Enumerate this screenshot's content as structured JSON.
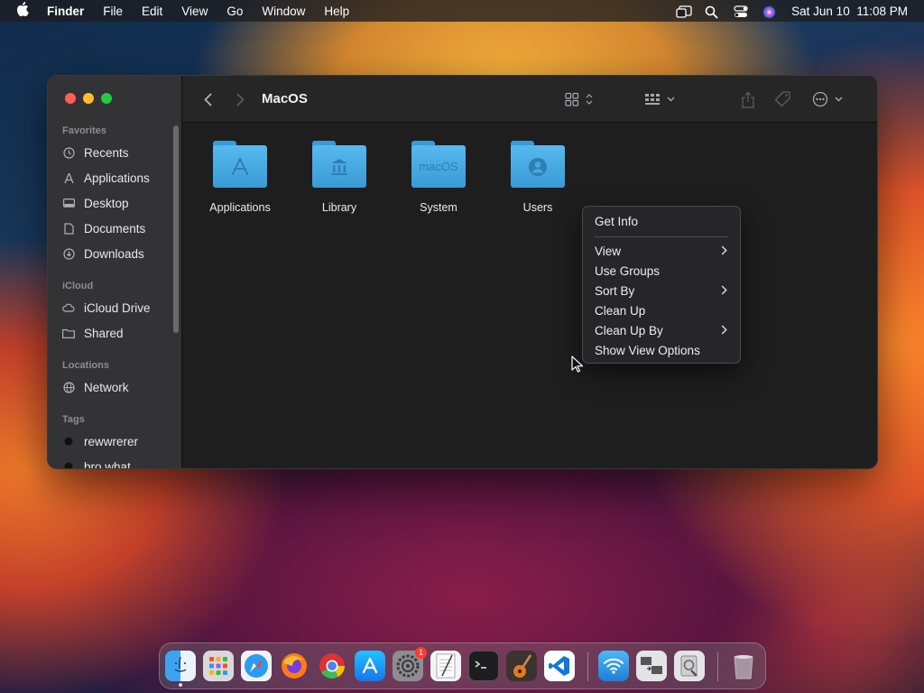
{
  "menubar": {
    "app_name": "Finder",
    "items": [
      "File",
      "Edit",
      "View",
      "Go",
      "Window",
      "Help"
    ],
    "datetime": "Sat Jun 10  11:08 PM"
  },
  "window": {
    "title": "MacOS",
    "sidebar": {
      "favorites_header": "Favorites",
      "favorites": [
        "Recents",
        "Applications",
        "Desktop",
        "Documents",
        "Downloads"
      ],
      "icloud_header": "iCloud",
      "icloud": [
        "iCloud Drive",
        "Shared"
      ],
      "locations_header": "Locations",
      "locations": [
        "Network"
      ],
      "tags_header": "Tags",
      "tags": [
        "rewwrerer",
        "bro what"
      ]
    },
    "folders": [
      {
        "label": "Applications",
        "icon": "app-store-glyph"
      },
      {
        "label": "Library",
        "icon": "building-glyph"
      },
      {
        "label": "System",
        "icon": "macos-text",
        "glyph_text": "macOS"
      },
      {
        "label": "Users",
        "icon": "user-glyph"
      }
    ]
  },
  "context_menu": {
    "items": [
      {
        "label": "Get Info",
        "submenu": false
      },
      {
        "label": "View",
        "submenu": true
      },
      {
        "label": "Use Groups",
        "submenu": false
      },
      {
        "label": "Sort By",
        "submenu": true
      },
      {
        "label": "Clean Up",
        "submenu": false
      },
      {
        "label": "Clean Up By",
        "submenu": true
      },
      {
        "label": "Show View Options",
        "submenu": false
      }
    ]
  },
  "dock": {
    "apps": [
      "Finder",
      "Launchpad",
      "Safari",
      "Firefox",
      "Chrome",
      "App Store",
      "System Settings",
      "TextEdit",
      "Terminal",
      "GarageBand",
      "Visual Studio Code",
      "Wireless Diagnostics",
      "Migration Assistant",
      "Disk Utility",
      "Trash"
    ],
    "settings_badge": "1"
  },
  "colors": {
    "close": "#ff5f57",
    "minimize": "#febc2e",
    "zoom": "#28c840",
    "folder": "#4aa9e2"
  }
}
